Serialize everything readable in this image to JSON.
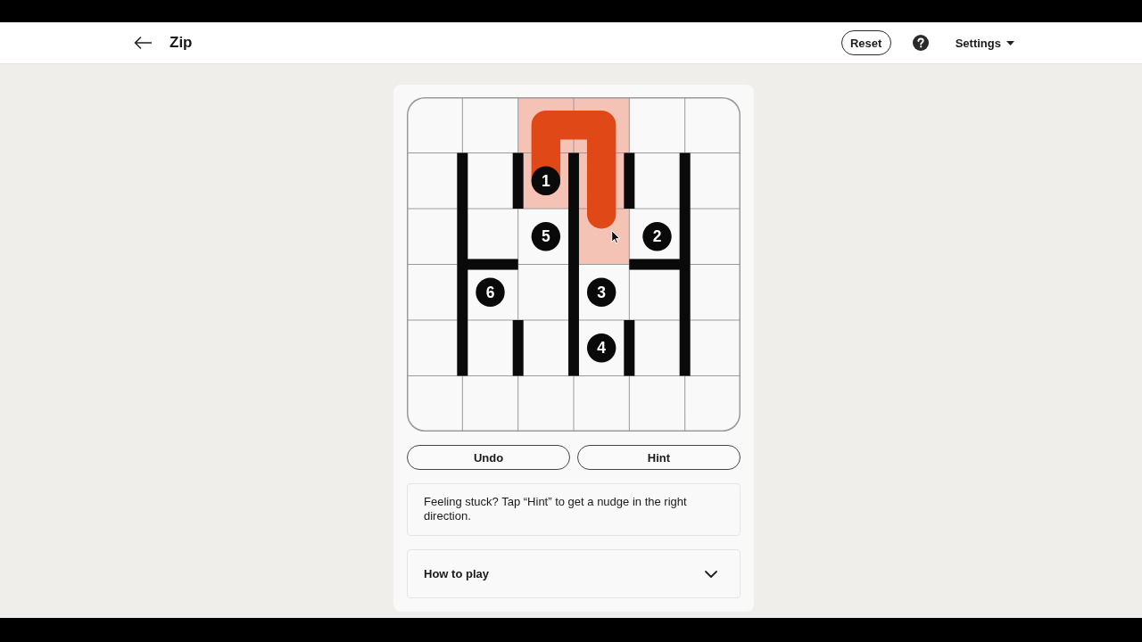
{
  "header": {
    "title": "Zip",
    "reset_button": "Reset",
    "settings_menu": "Settings"
  },
  "board": {
    "rows": [
      [
        {
          "kind": "open",
          "visited": false
        },
        {
          "kind": "open",
          "visited": false
        },
        {
          "kind": "open",
          "visited": true
        },
        {
          "kind": "open",
          "visited": true
        },
        {
          "kind": "open",
          "visited": false
        },
        {
          "kind": "open",
          "visited": false
        }
      ],
      [
        {
          "kind": "right",
          "visited": false
        },
        {
          "kind": "right",
          "visited": false
        },
        {
          "kind": "right",
          "visited": true,
          "number": "1"
        },
        {
          "kind": "right",
          "visited": true
        },
        {
          "kind": "right",
          "visited": false
        },
        {
          "kind": "open",
          "visited": false
        }
      ],
      [
        {
          "kind": "right",
          "visited": false
        },
        {
          "kind": "bottom",
          "visited": false
        },
        {
          "kind": "right",
          "visited": false,
          "number": "5"
        },
        {
          "kind": "open",
          "visited": true
        },
        {
          "kind": "both",
          "visited": false,
          "number": "2"
        },
        {
          "kind": "open",
          "visited": false
        }
      ],
      [
        {
          "kind": "right",
          "visited": false
        },
        {
          "kind": "open",
          "visited": false,
          "number": "6"
        },
        {
          "kind": "right",
          "visited": false
        },
        {
          "kind": "open",
          "visited": false,
          "number": "3"
        },
        {
          "kind": "right",
          "visited": false
        },
        {
          "kind": "open",
          "visited": false
        }
      ],
      [
        {
          "kind": "right",
          "visited": false
        },
        {
          "kind": "right",
          "visited": false
        },
        {
          "kind": "right",
          "visited": false
        },
        {
          "kind": "right",
          "visited": false,
          "number": "4"
        },
        {
          "kind": "right",
          "visited": false
        },
        {
          "kind": "open",
          "visited": false
        }
      ],
      [
        {
          "kind": "open",
          "visited": false
        },
        {
          "kind": "open",
          "visited": false
        },
        {
          "kind": "open",
          "visited": false
        },
        {
          "kind": "open",
          "visited": false
        },
        {
          "kind": "open",
          "visited": false
        },
        {
          "kind": "open",
          "visited": false
        }
      ]
    ]
  },
  "buttons": [
    "Undo",
    "Hint"
  ],
  "hint_text": "Feeling stuck? Tap “Hint” to get a nudge in the right direction.",
  "how_to_play": {
    "title": "How to play",
    "expanded": false
  }
}
